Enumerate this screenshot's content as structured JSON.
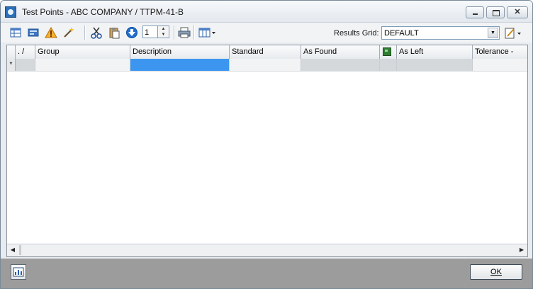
{
  "window": {
    "title": "Test Points - ABC COMPANY / TTPM-41-B",
    "controls": {
      "minimize_icon": "minimize-icon",
      "maximize_icon": "maximize-icon",
      "close_icon": "close-icon",
      "close_glyph": "✕"
    }
  },
  "toolbar": {
    "icons": [
      "table-view-icon",
      "record-icon",
      "warning-icon",
      "magic-wand-icon",
      "cut-icon",
      "paste-icon",
      "download-icon",
      "print-icon",
      "grid-layout-icon"
    ],
    "spin_value": "1",
    "results_grid_label": "Results Grid:",
    "results_grid_value": "DEFAULT"
  },
  "grid": {
    "columns": [
      ".  /",
      "Group",
      "Description",
      "Standard",
      "As Found",
      "",
      "As Left",
      "Tolerance -"
    ],
    "new_row_marker": "*"
  },
  "footer": {
    "report_icon": "report-icon",
    "ok_label": "OK"
  },
  "colors": {
    "selected_cell": "#3c96f0",
    "bottom_bar": "#9c9c9c"
  }
}
